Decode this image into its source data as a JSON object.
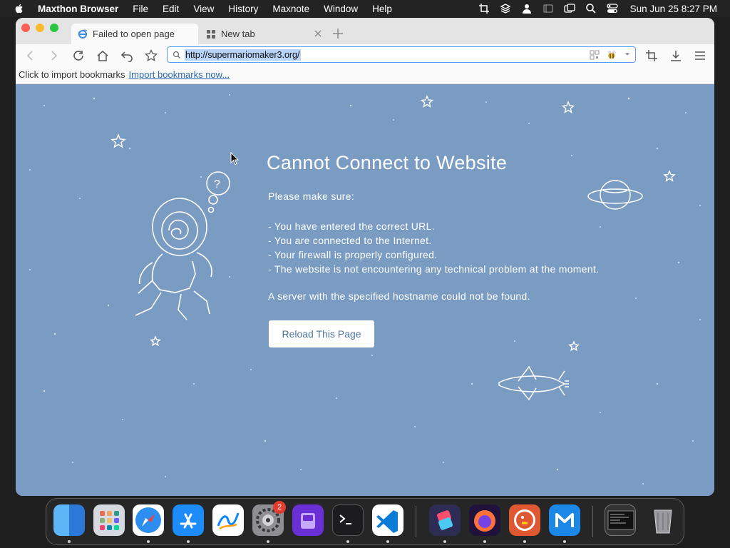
{
  "menubar": {
    "app_name": "Maxthon Browser",
    "items": [
      "File",
      "Edit",
      "View",
      "History",
      "Maxnote",
      "Window",
      "Help"
    ],
    "clock": "Sun Jun 25  8:27 PM"
  },
  "tabs": [
    {
      "label": "Failed to open page",
      "icon": "ie-e-icon",
      "active": true
    },
    {
      "label": "New tab",
      "icon": "grid-icon",
      "active": false
    }
  ],
  "address_bar": {
    "url": "http://supermariomaker3.org/"
  },
  "bookmarks_bar": {
    "prompt": "Click to import bookmarks",
    "link": "Import bookmarks now..."
  },
  "error_page": {
    "title": "Cannot Connect to Website",
    "intro": "Please make sure:",
    "checklist": [
      "- You have entered the correct URL.",
      "- You are connected to the Internet.",
      "- Your firewall is properly configured.",
      "- The website is not encountering any technical problem at the moment."
    ],
    "note": "A server with the specified hostname could not be found.",
    "reload_label": "Reload This Page"
  },
  "dock": {
    "apps": [
      "Finder",
      "Launchpad",
      "Safari",
      "App Store",
      "Freeform",
      "System Settings",
      "Apple Configurator",
      "Terminal",
      "Visual Studio Code",
      "Shortcuts",
      "Firefox",
      "DuckDuckGo",
      "Maxthon",
      "Screen Capture",
      "Trash"
    ],
    "settings_badge": "2"
  },
  "colors": {
    "content_bg": "#7b9cc2",
    "button_text": "#4d74a3",
    "accent": "#5b9bf3"
  }
}
